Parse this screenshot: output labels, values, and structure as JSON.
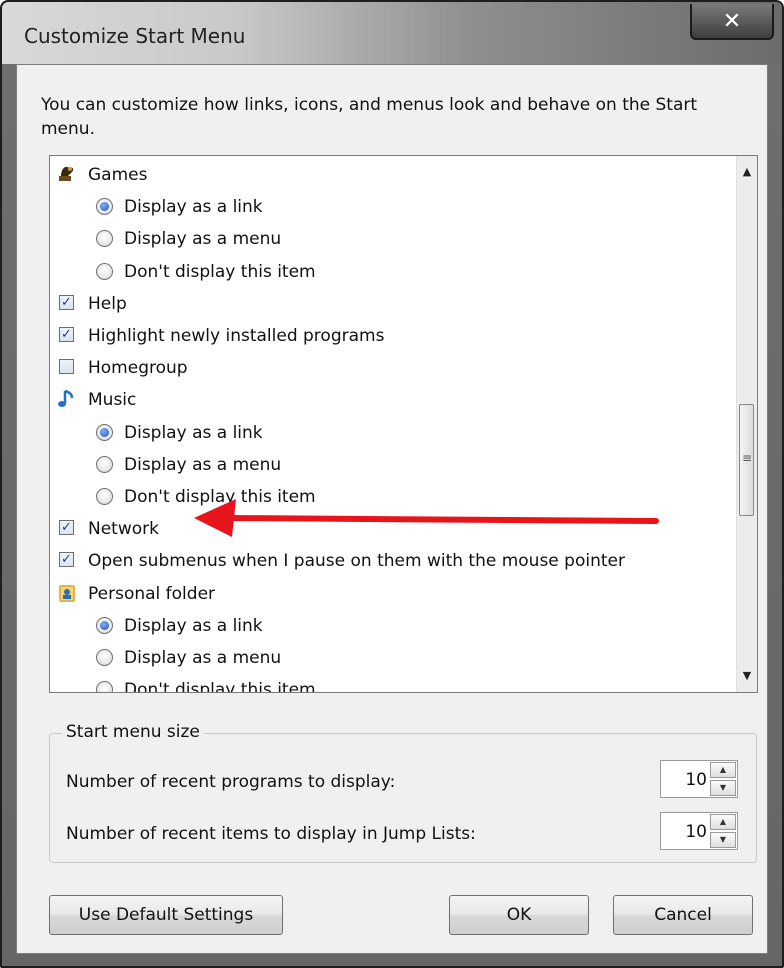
{
  "window": {
    "title": "Customize Start Menu",
    "close_glyph": "✕"
  },
  "description": "You can customize how links, icons, and menus look and behave on the Start menu.",
  "list_items": [
    {
      "kind": "icon",
      "icon": "games-icon",
      "label": "Games"
    },
    {
      "kind": "radio",
      "label": "Display as a link",
      "checked": true
    },
    {
      "kind": "radio",
      "label": "Display as a menu",
      "checked": false
    },
    {
      "kind": "radio",
      "label": "Don't display this item",
      "checked": false
    },
    {
      "kind": "check",
      "label": "Help",
      "checked": true
    },
    {
      "kind": "check",
      "label": "Highlight newly installed programs",
      "checked": true
    },
    {
      "kind": "check",
      "label": "Homegroup",
      "checked": false
    },
    {
      "kind": "icon",
      "icon": "music-icon",
      "label": "Music"
    },
    {
      "kind": "radio",
      "label": "Display as a link",
      "checked": true
    },
    {
      "kind": "radio",
      "label": "Display as a menu",
      "checked": false
    },
    {
      "kind": "radio",
      "label": "Don't display this item",
      "checked": false
    },
    {
      "kind": "check",
      "label": "Network",
      "checked": true
    },
    {
      "kind": "check",
      "label": "Open submenus when I pause on them with the mouse pointer",
      "checked": true
    },
    {
      "kind": "icon",
      "icon": "personal-folder-icon",
      "label": "Personal folder"
    },
    {
      "kind": "radio",
      "label": "Display as a link",
      "checked": true
    },
    {
      "kind": "radio",
      "label": "Display as a menu",
      "checked": false
    },
    {
      "kind": "radio",
      "label": "Don't display this item",
      "checked": false
    }
  ],
  "scrollbar": {
    "up_glyph": "▲",
    "down_glyph": "▼",
    "grip_glyph": "≡"
  },
  "start_menu_size": {
    "label": "Start menu size",
    "recent_programs_label": "Number of recent programs to display:",
    "recent_programs_value": "10",
    "jump_lists_label": "Number of recent items to display in Jump Lists:",
    "jump_lists_value": "10",
    "up_glyph": "▲",
    "down_glyph": "▼"
  },
  "buttons": {
    "defaults": "Use Default Settings",
    "ok": "OK",
    "cancel": "Cancel"
  },
  "colors": {
    "annotation_arrow": "#e8141c",
    "radio_selected": "#1c4fa8"
  }
}
